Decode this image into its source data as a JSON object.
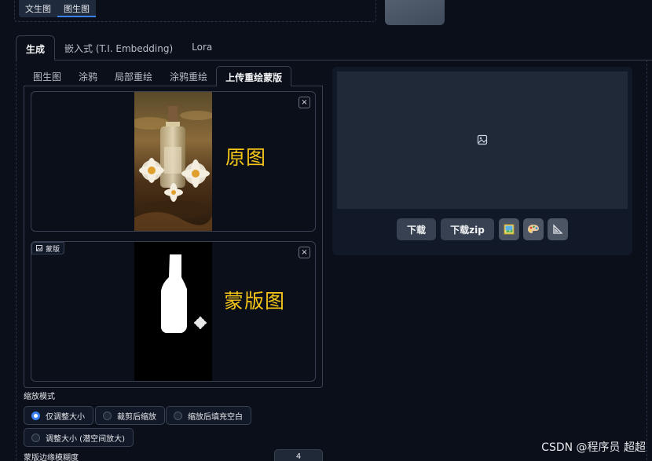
{
  "top_tabs": [
    "文生图",
    "图生图"
  ],
  "main_tabs": [
    "生成",
    "嵌入式 (T.I. Embedding)",
    "Lora"
  ],
  "sub_tabs": [
    "图生图",
    "涂鸦",
    "局部重绘",
    "涂鸦重绘",
    "上传重绘蒙版"
  ],
  "image_box": {
    "overlay": "原图",
    "close": "×"
  },
  "mask_box": {
    "label": "蒙版",
    "overlay": "蒙版图",
    "close": "×"
  },
  "resize_mode": {
    "label": "缩放模式",
    "options": [
      "仅调整大小",
      "裁剪后缩放",
      "缩放后填充空白",
      "调整大小 (潜空间放大)"
    ],
    "selected": 0
  },
  "mask_blur": {
    "label": "蒙版边缘模糊度",
    "value": "4"
  },
  "output": {
    "download": "下载",
    "download_zip": "下载zip"
  },
  "watermark": "CSDN @程序员 超超",
  "icons": [
    "image-placeholder-icon",
    "image-file-icon",
    "palette-icon",
    "ruler-icon"
  ]
}
